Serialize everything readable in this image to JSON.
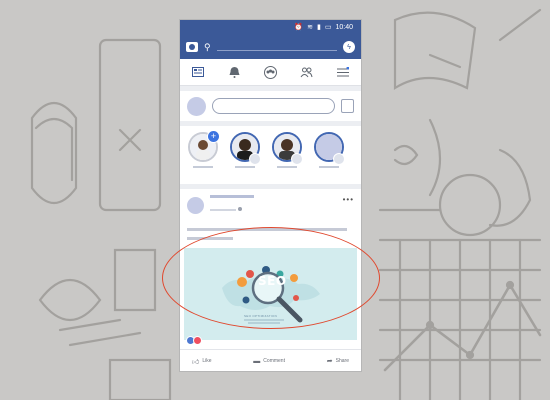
{
  "status_bar": {
    "time": "10:40"
  },
  "post": {
    "image_headline": "SEO",
    "image_subtitle": "SEO OPTIMIZATION",
    "actions": {
      "like": "Like",
      "comment": "Comment",
      "share": "Share"
    }
  },
  "colors": {
    "brand": "#3b5998",
    "story_ring": "#4267b2",
    "annotation": "#e0492f",
    "like": "#4d78d1",
    "love": "#f04f60"
  },
  "icons": {
    "top": [
      "camera-icon",
      "search-icon",
      "messenger-icon"
    ],
    "nav": [
      "news-feed-icon",
      "notifications-bell-icon",
      "groups-icon",
      "friends-icon",
      "menu-icon"
    ]
  }
}
